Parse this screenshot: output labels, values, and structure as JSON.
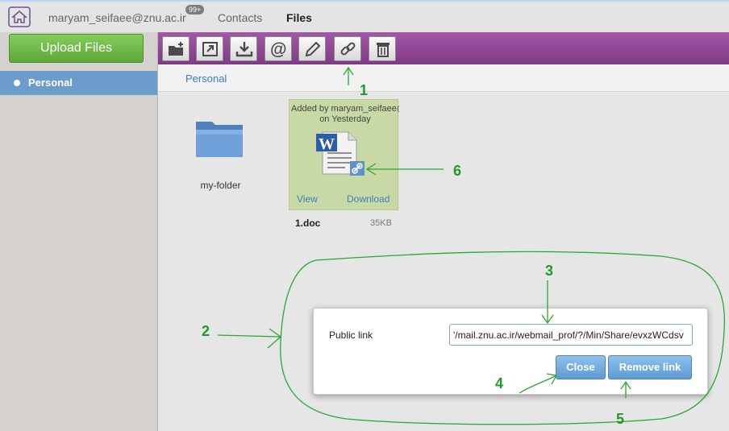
{
  "header": {
    "account": "maryam_seifaee@znu.ac.ir",
    "badge": "99+",
    "nav": {
      "contacts": "Contacts",
      "files": "Files"
    }
  },
  "sidebar": {
    "upload_label": "Upload Files",
    "items": [
      {
        "label": "Personal",
        "selected": true
      }
    ]
  },
  "toolbar": {
    "buttons": [
      "new-folder-icon",
      "open-icon",
      "download-icon",
      "email-icon",
      "rename-icon",
      "link-icon",
      "delete-icon"
    ]
  },
  "breadcrumb": "Personal",
  "files": {
    "folder": {
      "name": "my-folder"
    },
    "file": {
      "added_line1": "Added by maryam_seifaee@",
      "added_line2": "on Yesterday",
      "view_label": "View",
      "download_label": "Download",
      "name": "1.doc",
      "size": "35KB"
    }
  },
  "dialog": {
    "label": "Public link",
    "link_value": "'/mail.znu.ac.ir/webmail_prof/?/Min/Share/evxzWCdsv",
    "close_label": "Close",
    "remove_label": "Remove link"
  },
  "annotations": [
    "1",
    "2",
    "3",
    "4",
    "5",
    "6"
  ],
  "colors": {
    "toolbar": "#8f4795",
    "upload_button": "#6ab447",
    "sidebar_selected": "#6c9ccb",
    "dialog_button": "#74ace0",
    "annotation": "#1f9a2a"
  }
}
